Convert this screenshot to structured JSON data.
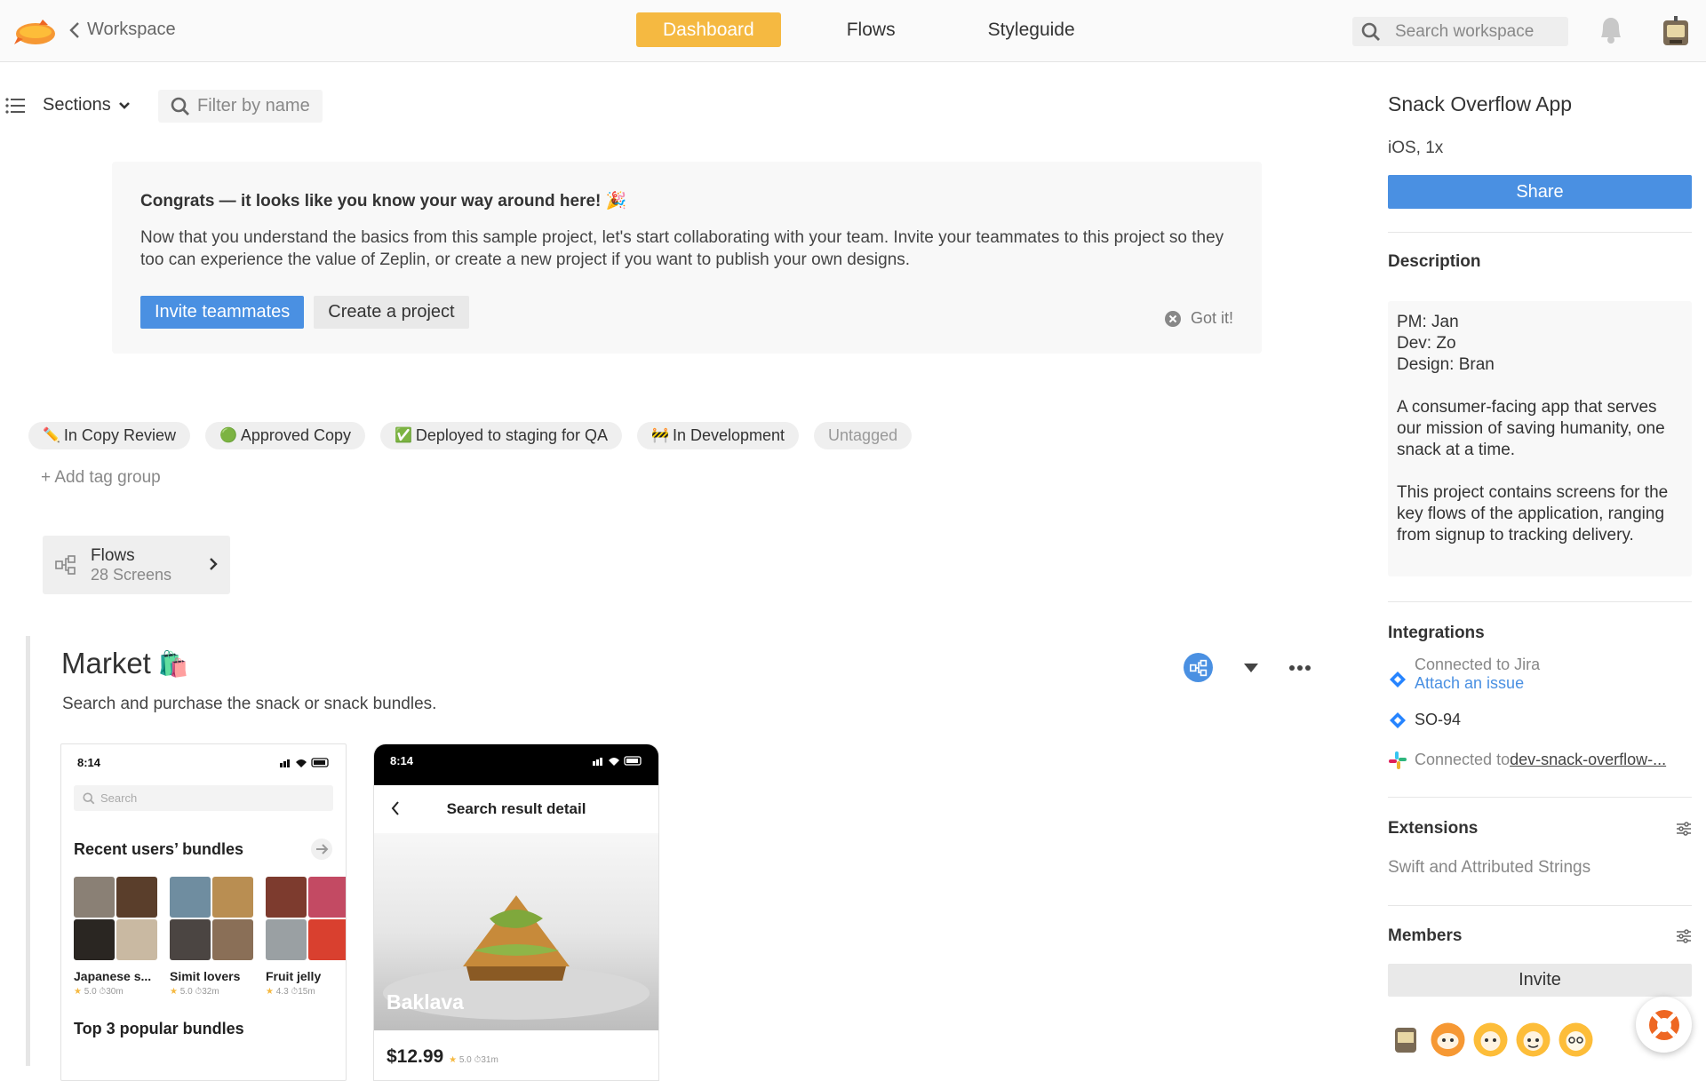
{
  "topbar": {
    "back_label": "Workspace",
    "tabs": [
      {
        "label": "Dashboard",
        "active": true
      },
      {
        "label": "Flows",
        "active": false
      },
      {
        "label": "Styleguide",
        "active": false
      }
    ],
    "search_placeholder": "Search workspace"
  },
  "toolbar": {
    "sections_label": "Sections",
    "filter_placeholder": "Filter by name"
  },
  "congrats": {
    "title": "Congrats — it looks like you know your way around here! 🎉",
    "body": "Now that you understand the basics from this sample project, let's start collaborating with your team. Invite your teammates to this project so they too can experience the value of Zeplin, or create a new project if you want to publish your own designs.",
    "invite_label": "Invite teammates",
    "create_label": "Create a project",
    "gotit_label": "Got it!"
  },
  "tags": [
    {
      "emoji": "✏️",
      "label": "In Copy Review"
    },
    {
      "emoji": "🟢",
      "label": "Approved Copy"
    },
    {
      "emoji": "✅",
      "label": "Deployed to staging for QA"
    },
    {
      "emoji": "🚧",
      "label": "In Development"
    },
    {
      "emoji": "",
      "label": "Untagged"
    }
  ],
  "add_tag_label": "+ Add tag group",
  "flows_card": {
    "title": "Flows",
    "subtitle": "28 Screens"
  },
  "market": {
    "title": "Market",
    "emoji": "🛍️",
    "description": "Search and purchase the snack or snack bundles.",
    "screen1": {
      "time": "8:14",
      "search_placeholder": "Search",
      "heading": "Recent users’ bundles",
      "bundles": [
        {
          "name": "Japanese s...",
          "rating": "5.0",
          "time": "30m",
          "colors": [
            "#8a8075",
            "#5a3e2b",
            "#2a2622",
            "#c9b9a2"
          ]
        },
        {
          "name": "Simit lovers",
          "rating": "5.0",
          "time": "32m",
          "colors": [
            "#6f8da0",
            "#b98e52",
            "#4b4542",
            "#8a6f57"
          ]
        },
        {
          "name": "Fruit jelly",
          "rating": "4.3",
          "time": "15m",
          "colors": [
            "#7d3b2e",
            "#c34a63",
            "#9aa0a3",
            "#d9402f"
          ]
        }
      ],
      "heading2": "Top 3 popular bundles"
    },
    "screen2": {
      "time": "8:14",
      "header": "Search result detail",
      "food_label": "Baklava",
      "price": "$12.99",
      "rating": "5.0",
      "time_meta": "31m"
    }
  },
  "panel": {
    "project_title": "Snack Overflow App",
    "platform": "iOS, 1x",
    "share_label": "Share",
    "description_heading": "Description",
    "description": "PM: Jan\nDev: Zo\nDesign: Bran\n\nA consumer-facing app that serves our mission of saving humanity, one snack at a time.\n\nThis project contains screens for the key flows of the application, ranging from signup to tracking delivery.",
    "integrations_heading": "Integrations",
    "jira_connected": "Connected to Jira",
    "jira_attach": "Attach an issue",
    "jira_issue": "SO-94",
    "slack_prefix": "Connected to ",
    "slack_channel": "dev-snack-overflow-...",
    "extensions_heading": "Extensions",
    "extension_name": "Swift and Attributed Strings",
    "members_heading": "Members",
    "invite_label": "Invite"
  },
  "colors": {
    "accent_yellow": "#f5b941",
    "primary_blue": "#4a90e2"
  }
}
